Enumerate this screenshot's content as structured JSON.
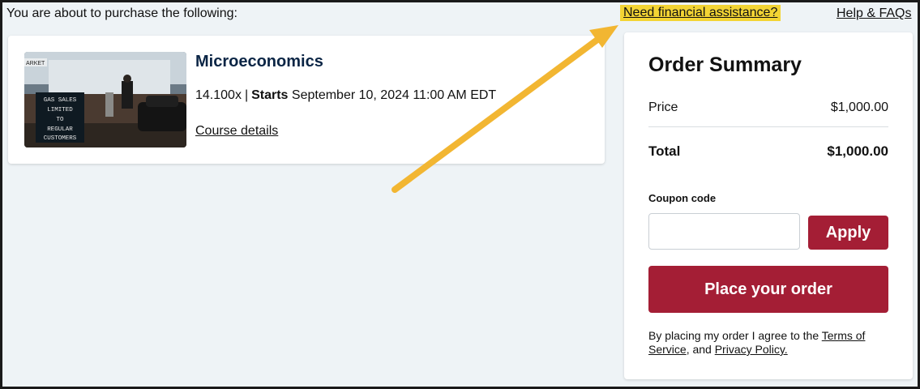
{
  "intro_text": "You are about to purchase the following:",
  "links": {
    "financial_assistance": "Need financial assistance?",
    "help": "Help & FAQs"
  },
  "course": {
    "title": "Microeconomics",
    "code": "14.100x",
    "separator": "|",
    "starts_label": "Starts",
    "starts_date": "September 10, 2024 11:00 AM EDT",
    "details_link": "Course details",
    "thumbnail_sign": [
      "GAS SALES",
      "LIMITED",
      "TO",
      "REGULAR",
      "CUSTOMERS"
    ],
    "thumbnail_store_sign": "ARKET"
  },
  "summary": {
    "title": "Order Summary",
    "price_label": "Price",
    "price_value": "$1,000.00",
    "total_label": "Total",
    "total_value": "$1,000.00",
    "coupon_label": "Coupon code",
    "coupon_value": "",
    "apply_label": "Apply",
    "place_order_label": "Place your order",
    "terms_prefix": "By placing my order I agree to the ",
    "terms_link": "Terms of Service",
    "terms_mid": ", and ",
    "privacy_link": "Privacy Policy."
  },
  "colors": {
    "page_bg": "#eef3f6",
    "brand_red": "#a41e35",
    "highlight_yellow": "#f3d434",
    "arrow_orange": "#f2b632",
    "title_navy": "#0b2545"
  }
}
